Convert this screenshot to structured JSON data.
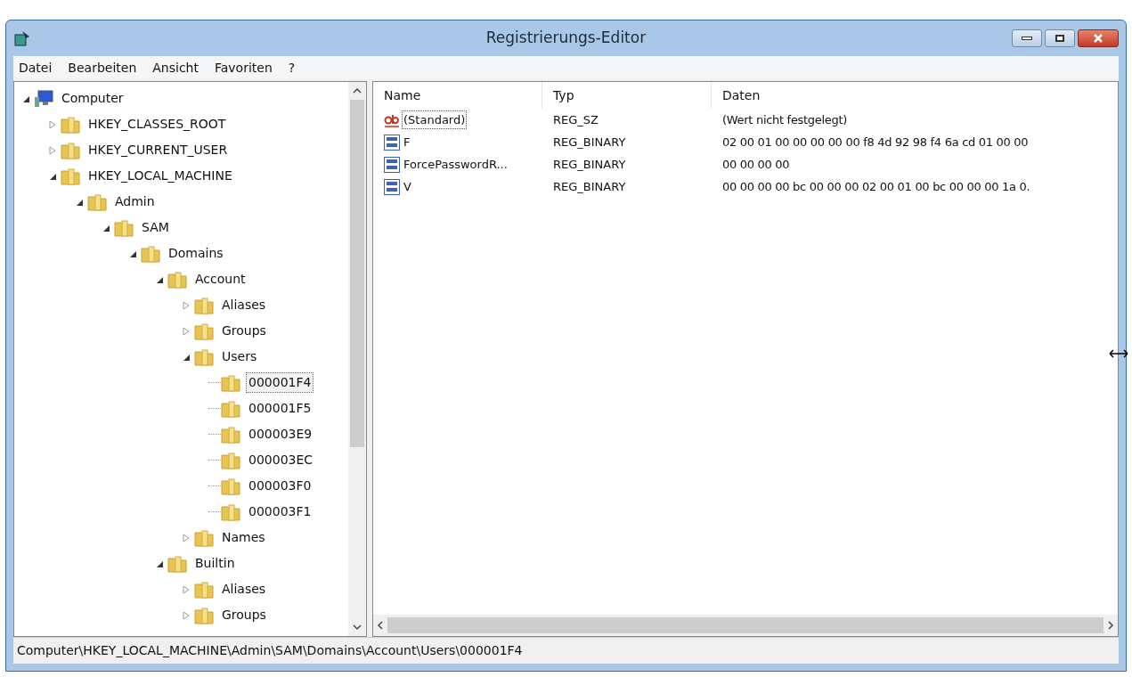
{
  "window": {
    "title": "Registrierungs-Editor"
  },
  "menu": [
    "Datei",
    "Bearbeiten",
    "Ansicht",
    "Favoriten",
    "?"
  ],
  "tree": [
    {
      "label": "Computer",
      "kind": "computer",
      "expanded": true,
      "selected": false,
      "children": [
        {
          "label": "HKEY_CLASSES_ROOT",
          "kind": "folder",
          "expanded": false,
          "selected": false
        },
        {
          "label": "HKEY_CURRENT_USER",
          "kind": "folder",
          "expanded": false,
          "selected": false
        },
        {
          "label": "HKEY_LOCAL_MACHINE",
          "kind": "folder",
          "expanded": true,
          "selected": false,
          "children": [
            {
              "label": "Admin",
              "kind": "folder",
              "expanded": true,
              "selected": false,
              "children": [
                {
                  "label": "SAM",
                  "kind": "folder",
                  "expanded": true,
                  "selected": false,
                  "children": [
                    {
                      "label": "Domains",
                      "kind": "folder",
                      "expanded": true,
                      "selected": false,
                      "children": [
                        {
                          "label": "Account",
                          "kind": "folder",
                          "expanded": true,
                          "selected": false,
                          "children": [
                            {
                              "label": "Aliases",
                              "kind": "folder",
                              "expanded": false,
                              "selected": false
                            },
                            {
                              "label": "Groups",
                              "kind": "folder",
                              "expanded": false,
                              "selected": false
                            },
                            {
                              "label": "Users",
                              "kind": "folder",
                              "expanded": true,
                              "selected": false,
                              "children": [
                                {
                                  "label": "000001F4",
                                  "kind": "leaf",
                                  "selected": true
                                },
                                {
                                  "label": "000001F5",
                                  "kind": "leaf",
                                  "selected": false
                                },
                                {
                                  "label": "000003E9",
                                  "kind": "leaf",
                                  "selected": false
                                },
                                {
                                  "label": "000003EC",
                                  "kind": "leaf",
                                  "selected": false
                                },
                                {
                                  "label": "000003F0",
                                  "kind": "leaf",
                                  "selected": false
                                },
                                {
                                  "label": "000003F1",
                                  "kind": "leaf",
                                  "selected": false
                                }
                              ]
                            },
                            {
                              "label": "Names",
                              "kind": "folder",
                              "expanded": false,
                              "selected": false
                            }
                          ]
                        },
                        {
                          "label": "Builtin",
                          "kind": "folder",
                          "expanded": true,
                          "selected": false,
                          "children": [
                            {
                              "label": "Aliases",
                              "kind": "folder",
                              "expanded": false,
                              "selected": false
                            },
                            {
                              "label": "Groups",
                              "kind": "folder",
                              "expanded": false,
                              "selected": false
                            }
                          ]
                        }
                      ]
                    }
                  ]
                }
              ]
            }
          ]
        }
      ]
    }
  ],
  "table": {
    "columns": [
      "Name",
      "Typ",
      "Daten"
    ],
    "rows": [
      {
        "kind": "string",
        "name": "(Standard)",
        "type": "REG_SZ",
        "data": "(Wert nicht festgelegt)",
        "selected": true
      },
      {
        "kind": "binary",
        "name": "F",
        "type": "REG_BINARY",
        "data": "02 00 01 00 00 00 00 00 f8 4d 92 98 f4 6a cd 01 00 00",
        "selected": false
      },
      {
        "kind": "binary",
        "name": "ForcePasswordR...",
        "type": "REG_BINARY",
        "data": "00 00 00 00",
        "selected": false
      },
      {
        "kind": "binary",
        "name": "V",
        "type": "REG_BINARY",
        "data": "00 00 00 00 bc 00 00 00 02 00 01 00 bc 00 00 00 1a 0.",
        "selected": false
      }
    ]
  },
  "status_bar": "Computer\\HKEY_LOCAL_MACHINE\\Admin\\SAM\\Domains\\Account\\Users\\000001F4"
}
